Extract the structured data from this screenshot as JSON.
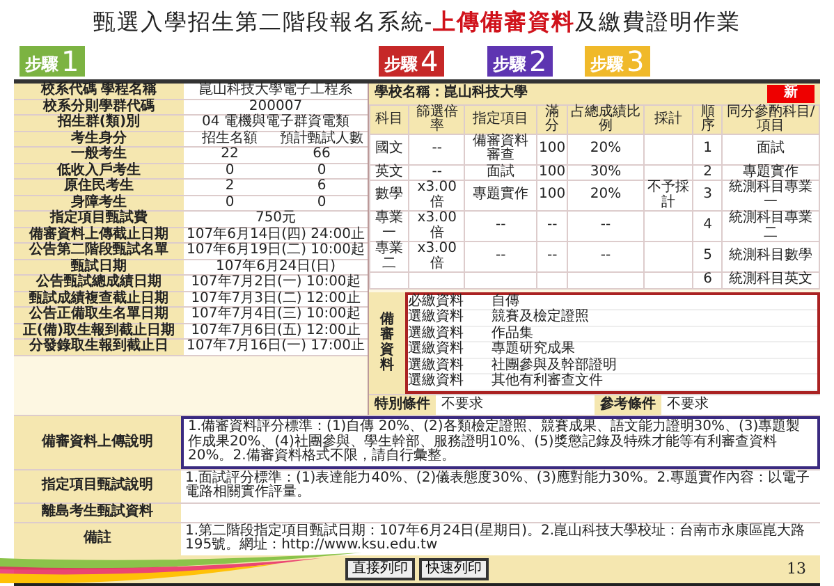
{
  "slide": {
    "title_parts": [
      {
        "text": "甄選入學招生第二階段報名系統-",
        "kind": "plain"
      },
      {
        "text": "上傳備審資料",
        "kind": "highlight"
      },
      {
        "text": "及繳費證明作業",
        "kind": "plain"
      }
    ],
    "page_number": "13"
  },
  "steps": [
    {
      "label": "步驟",
      "number": "1",
      "color": "#7cb342"
    },
    {
      "label": "步驟",
      "number": "4",
      "color": "#c62828"
    },
    {
      "label": "步驟",
      "number": "2",
      "color": "#5e35b1"
    },
    {
      "label": "步驟",
      "number": "3",
      "color": "#f0b92a"
    }
  ],
  "info_rows": [
    {
      "label": "校系代碼 學程名稱",
      "values": [
        "崑山科技大學電子工程系"
      ]
    },
    {
      "label": "校系分則學群代碼",
      "values": [
        "200007"
      ]
    },
    {
      "label": "招生群(類)別",
      "values": [
        "04 電機與電子群資電類"
      ]
    },
    {
      "label": "考生身分",
      "values": [
        "招生名額",
        "預計甄試人數"
      ]
    },
    {
      "label": "一般考生",
      "values": [
        "22",
        "66"
      ]
    },
    {
      "label": "低收入戶考生",
      "values": [
        "0",
        "0"
      ]
    },
    {
      "label": "原住民考生",
      "values": [
        "2",
        "6"
      ]
    },
    {
      "label": "身障考生",
      "values": [
        "0",
        "0"
      ]
    },
    {
      "label": "指定項目甄試費",
      "values": [
        "750元"
      ]
    },
    {
      "label": "備審資料上傳截止日期",
      "values": [
        "107年6月14日(四) 24:00止"
      ]
    },
    {
      "label": "公告第二階段甄試名單",
      "values": [
        "107年6月19日(二) 10:00起"
      ]
    },
    {
      "label": "甄試日期",
      "values": [
        "107年6月24日(日)"
      ]
    },
    {
      "label": "公告甄試總成績日期",
      "values": [
        "107年7月2日(一) 10:00起"
      ]
    },
    {
      "label": "甄試成績複查截止日期",
      "values": [
        "107年7月3日(二) 12:00止"
      ]
    },
    {
      "label": "公告正備取生名單日期",
      "values": [
        "107年7月4日(三) 10:00起"
      ]
    },
    {
      "label": "正(備)取生報到截止日期",
      "values": [
        "107年7月6日(五) 12:00止"
      ]
    },
    {
      "label": "分發錄取生報到截止日",
      "values": [
        "107年7月16日(一) 17:00止"
      ]
    }
  ],
  "school": {
    "name": "學校名稱：崑山科技大學",
    "badge": "新"
  },
  "score_table": {
    "columns": [
      "科目",
      "篩選倍率",
      "指定項目",
      "滿分",
      "占總成績比例",
      "採計",
      "順序",
      "同分參酌科目/項目"
    ],
    "rows": [
      {
        "cells": [
          "國文",
          "--",
          "備審資料審查",
          "100",
          "20%",
          "",
          "1",
          "面試"
        ]
      },
      {
        "cells": [
          "英文",
          "--",
          "面試",
          "100",
          "30%",
          "",
          "2",
          "專題實作"
        ]
      },
      {
        "cells": [
          "數學",
          "x3.00倍",
          "專題實作",
          "100",
          "20%",
          "不予採計",
          "3",
          "統測科目專業一"
        ]
      },
      {
        "cells": [
          "專業一",
          "x3.00倍",
          "--",
          "--",
          "--",
          "",
          "4",
          "統測科目專業二"
        ]
      },
      {
        "cells": [
          "專業二",
          "x3.00倍",
          "--",
          "--",
          "--",
          "",
          "5",
          "統測科目數學"
        ]
      },
      {
        "cells": [
          "",
          "",
          "",
          "",
          "",
          "",
          "6",
          "統測科目英文"
        ]
      }
    ]
  },
  "review_materials": {
    "heading": "備審資料",
    "items": [
      {
        "type": "必繳資料",
        "name": "自傳"
      },
      {
        "type": "選繳資料",
        "name": "競賽及檢定證照"
      },
      {
        "type": "選繳資料",
        "name": "作品集"
      },
      {
        "type": "選繳資料",
        "name": "專題研究成果"
      },
      {
        "type": "選繳資料",
        "name": "社團參與及幹部證明"
      },
      {
        "type": "選繳資料",
        "name": "其他有利審查文件"
      }
    ]
  },
  "conditions": [
    {
      "label": "特別條件",
      "value": "不要求"
    },
    {
      "label": "參考條件",
      "value": "不要求"
    }
  ],
  "notes": [
    {
      "label": "備審資料上傳說明",
      "text": "1.備審資料評分標準：(1)自傳 20%、(2)各類檢定證照、競賽成果、語文能力證明30%、(3)專題製作成果20%、(4)社團參與、學生幹部、服務證明10%、(5)獎懲記錄及特殊才能等有利審查資料20%。2.備審資料格式不限，請自行彙整。",
      "highlight": true
    },
    {
      "label": "指定項目甄試說明",
      "text": "1.面試評分標準：(1)表達能力40%、(2)儀表態度30%、(3)應對能力30%。2.專題實作內容：以電子電路相關實作評量。",
      "highlight": false
    },
    {
      "label": "離島考生甄試資料",
      "highlight": false
    },
    {
      "label": "備註",
      "text": "1.第二階段指定項目甄試日期：107年6月24日(星期日)。2.崑山科技大學校址：台南市永康區崑大路195號。網址：http://www.ksu.edu.tw",
      "highlight": false
    }
  ],
  "buttons": [
    "直接列印",
    "快速列印"
  ]
}
